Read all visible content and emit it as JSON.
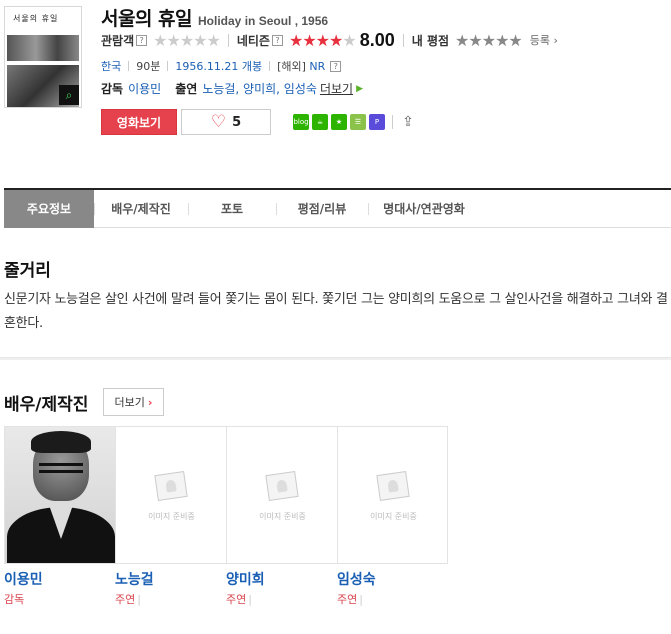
{
  "movie": {
    "title_ko": "서울의 휴일",
    "title_en": "Holiday in Seoul , 1956",
    "poster_title": "서울의 휴일"
  },
  "ratings": {
    "audience_label": "관람객",
    "netizen_label": "네티즌",
    "netizen_score": "8.00",
    "netizen_stars": 4,
    "my_label": "내 평점",
    "register_label": "등록",
    "help_icon": "?"
  },
  "meta": {
    "country": "한국",
    "runtime": "90분",
    "release": "1956.11.21 개봉",
    "rating_prefix": "[해외]",
    "rating": "NR"
  },
  "crew": {
    "director_label": "감독",
    "director": "이용민",
    "cast_label": "출연",
    "cast_names": "노능걸, 양미희, 임성숙",
    "more_label": "더보기"
  },
  "actions": {
    "watch_label": "영화보기",
    "like_count": "5",
    "share_icons": [
      "blog",
      "cafe",
      "star",
      "list",
      "p",
      "share-out"
    ]
  },
  "tabs": [
    "주요정보",
    "배우/제작진",
    "포토",
    "평점/리뷰",
    "명대사/연관영화"
  ],
  "synopsis": {
    "title": "줄거리",
    "text": "신문기자 노능걸은 살인 사건에 말려 들어 쫓기는 몸이 된다. 쫓기던 그는 양미희의 도움으로 그 살인사건을 해결하고 그녀와 결혼한다."
  },
  "cast_section": {
    "title": "배우/제작진",
    "more_label": "더보기",
    "placeholder_text": "이미지 준비중",
    "people": [
      {
        "name": "이용민",
        "role": "감독"
      },
      {
        "name": "노능걸",
        "role": "주연"
      },
      {
        "name": "양미희",
        "role": "주연"
      },
      {
        "name": "임성숙",
        "role": "주연"
      }
    ]
  },
  "colors": {
    "accent_red": "#e5424d",
    "link_blue": "#1a5fb4",
    "tab_active": "#888888"
  }
}
